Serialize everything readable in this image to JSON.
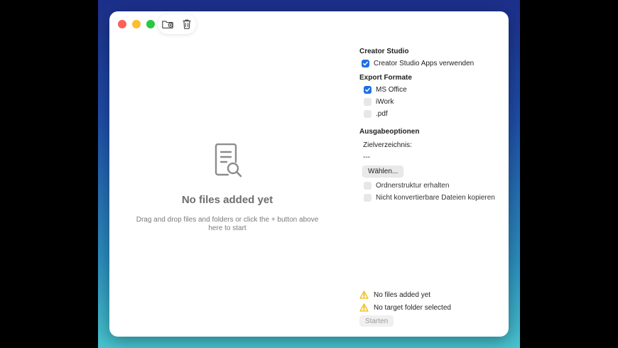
{
  "toolbar": {
    "add_folder_icon": "folder-plus-icon",
    "delete_icon": "trash-icon"
  },
  "empty_state": {
    "icon": "document-search-icon",
    "title": "No files added yet",
    "subtitle": "Drag and drop files and folders or click the + button above here to start"
  },
  "sidebar": {
    "creator_studio": {
      "title": "Creator Studio",
      "use_apps_label": "Creator Studio Apps verwenden",
      "use_apps_checked": true
    },
    "export_formats": {
      "title": "Export Formate",
      "options": [
        {
          "label": "MS Office",
          "checked": true
        },
        {
          "label": "iWork",
          "checked": false
        },
        {
          "label": ".pdf",
          "checked": false
        }
      ]
    },
    "output_options": {
      "title": "Ausgabeoptionen",
      "target_label": "Zielverzeichnis:",
      "target_value": "---",
      "choose_button": "Wählen...",
      "keep_structure_label": "Ordnerstruktur erhalten",
      "keep_structure_checked": false,
      "copy_unconvertible_label": "Nicht konvertierbare Dateien kopieren",
      "copy_unconvertible_checked": false
    },
    "warnings": [
      {
        "icon": "warning-icon",
        "text": "No files added yet"
      },
      {
        "icon": "warning-icon",
        "text": "No target folder selected"
      }
    ],
    "start_button": "Starten"
  },
  "colors": {
    "accent": "#1f6fe5",
    "warning": "#f5c518",
    "close": "#fe5f57",
    "minimize": "#febc2e",
    "zoom": "#28c840"
  }
}
